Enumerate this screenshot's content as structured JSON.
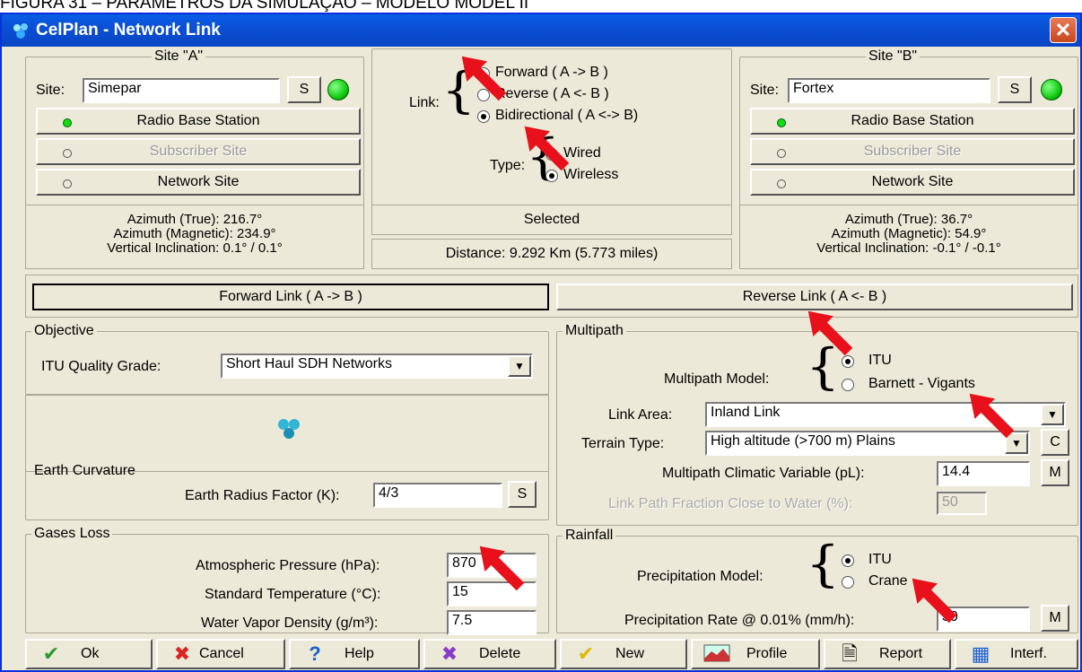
{
  "caption": "FIGURA 31 – PARÂMETROS DA SIMULAÇÃO – MODELO MODEL II",
  "window": {
    "title": "CelPlan - Network Link",
    "close_label": "✕"
  },
  "site_a": {
    "legend": "Site \"A\"",
    "site_label": "Site:",
    "site_value": "Simepar",
    "s_btn": "S",
    "buttons": [
      "Radio Base Station",
      "Subscriber Site",
      "Network Site"
    ],
    "info": [
      "Azimuth (True): 216.7°",
      "Azimuth (Magnetic): 234.9°",
      "Vertical Inclination: 0.1° / 0.1°"
    ]
  },
  "site_b": {
    "legend": "Site \"B\"",
    "site_label": "Site:",
    "site_value": "Fortex",
    "s_btn": "S",
    "buttons": [
      "Radio Base Station",
      "Subscriber Site",
      "Network Site"
    ],
    "info": [
      "Azimuth (True): 36.7°",
      "Azimuth (Magnetic): 54.9°",
      "Vertical Inclination: -0.1° / -0.1°"
    ]
  },
  "link": {
    "label": "Link:",
    "options": [
      "Forward ( A -> B )",
      "Reverse ( A <- B )",
      "Bidirectional ( A <-> B)"
    ],
    "selected": 2,
    "type_label": "Type:",
    "type_options": [
      "Wired",
      "Wireless"
    ],
    "type_selected": 1,
    "selected_text": "Selected",
    "distance": "Distance: 9.292 Km (5.773 miles)"
  },
  "tabs": {
    "forward": "Forward Link ( A -> B )",
    "reverse": "Reverse Link ( A <- B )"
  },
  "objective": {
    "legend": "Objective",
    "label": "ITU Quality Grade:",
    "value": "Short Haul SDH Networks"
  },
  "earth": {
    "legend": "Earth Curvature",
    "label": "Earth Radius Factor (K):",
    "value": "4/3",
    "btn": "S"
  },
  "gases": {
    "legend": "Gases Loss",
    "fields": [
      {
        "label": "Atmospheric Pressure (hPa):",
        "value": "870"
      },
      {
        "label": "Standard Temperature (°C):",
        "value": "15"
      },
      {
        "label": "Water Vapor Density (g/m³):",
        "value": "7.5"
      }
    ]
  },
  "multipath": {
    "legend": "Multipath",
    "model_label": "Multipath Model:",
    "models": [
      "ITU",
      "Barnett - Vigants"
    ],
    "model_selected": 0,
    "area_label": "Link Area:",
    "area_value": "Inland Link",
    "terrain_label": "Terrain Type:",
    "terrain_value": "High altitude (>700 m) Plains",
    "terrain_btn": "C",
    "climatic_label": "Multipath Climatic Variable (pL):",
    "climatic_value": "14.4",
    "climatic_btn": "M",
    "water_label": "Link Path Fraction Close to Water (%):",
    "water_value": "50"
  },
  "rainfall": {
    "legend": "Rainfall",
    "model_label": "Precipitation Model:",
    "models": [
      "ITU",
      "Crane"
    ],
    "model_selected": 0,
    "rate_label": "Precipitation Rate @ 0.01% (mm/h):",
    "rate_value": "30",
    "rate_btn": "M"
  },
  "toolbar": [
    "Ok",
    "Cancel",
    "Help",
    "Delete",
    "New",
    "Profile",
    "Report",
    "Interf."
  ],
  "colors": {
    "title_bar": "#0a5ee8",
    "led": "#22cc22",
    "annotation_arrow": "#e8101a"
  }
}
